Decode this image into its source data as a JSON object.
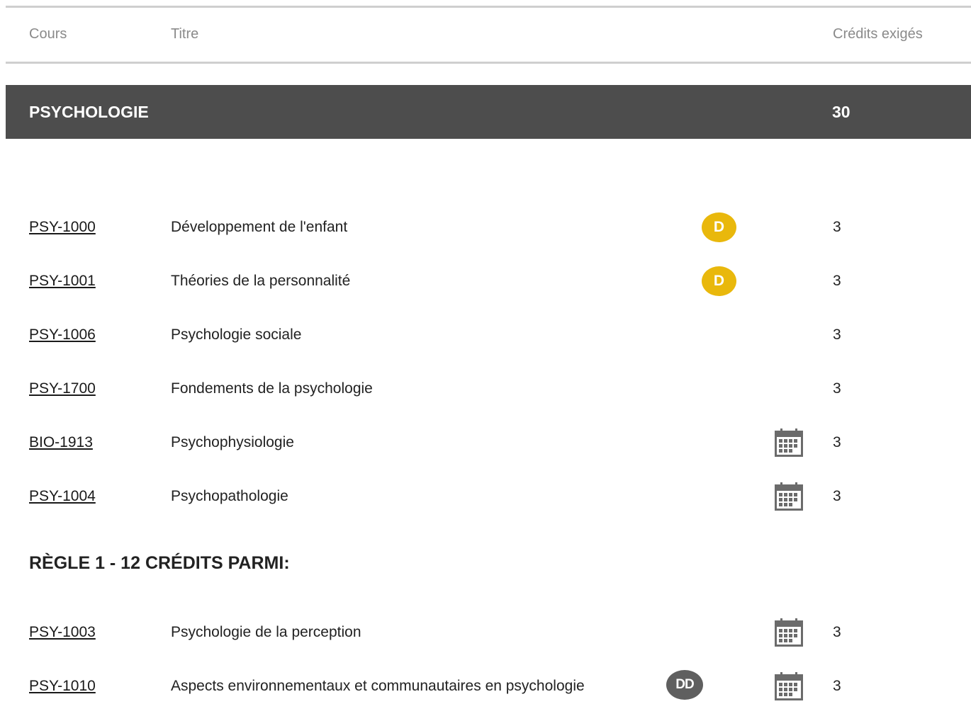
{
  "table_header": {
    "course": "Cours",
    "title": "Titre",
    "credits": "Crédits exigés"
  },
  "section": {
    "title": "PSYCHOLOGIE",
    "credits": "30"
  },
  "mandatory_courses": [
    {
      "code": "PSY-1000",
      "title": "Développement de l'enfant",
      "badge": "D",
      "calendar": false,
      "credits": "3"
    },
    {
      "code": "PSY-1001",
      "title": "Théories de la personnalité",
      "badge": "D",
      "calendar": false,
      "credits": "3"
    },
    {
      "code": "PSY-1006",
      "title": "Psychologie sociale",
      "badge": "",
      "calendar": false,
      "credits": "3"
    },
    {
      "code": "PSY-1700",
      "title": "Fondements de la psychologie",
      "badge": "",
      "calendar": false,
      "credits": "3"
    },
    {
      "code": "BIO-1913",
      "title": "Psychophysiologie",
      "badge": "",
      "calendar": true,
      "credits": "3"
    },
    {
      "code": "PSY-1004",
      "title": "Psychopathologie",
      "badge": "",
      "calendar": true,
      "credits": "3"
    }
  ],
  "rule": {
    "title": "RÈGLE 1 - 12 CRÉDITS PARMI:"
  },
  "rule_courses": [
    {
      "code": "PSY-1003",
      "title": "Psychologie de la perception",
      "badge": "",
      "calendar": true,
      "credits": "3"
    },
    {
      "code": "PSY-1010",
      "title": "Aspects environnementaux et communautaires en psychologie",
      "badge": "DD",
      "calendar": true,
      "credits": "3"
    }
  ],
  "colors": {
    "section_bar": "#4d4d4d",
    "badge_d": "#e9b80c",
    "badge_dd": "#5f5f5f",
    "header_text": "#8a8a8a"
  },
  "icons": {
    "calendar": "calendar-icon",
    "badge_d": "d-badge-icon",
    "badge_dd": "dd-badge-icon"
  }
}
